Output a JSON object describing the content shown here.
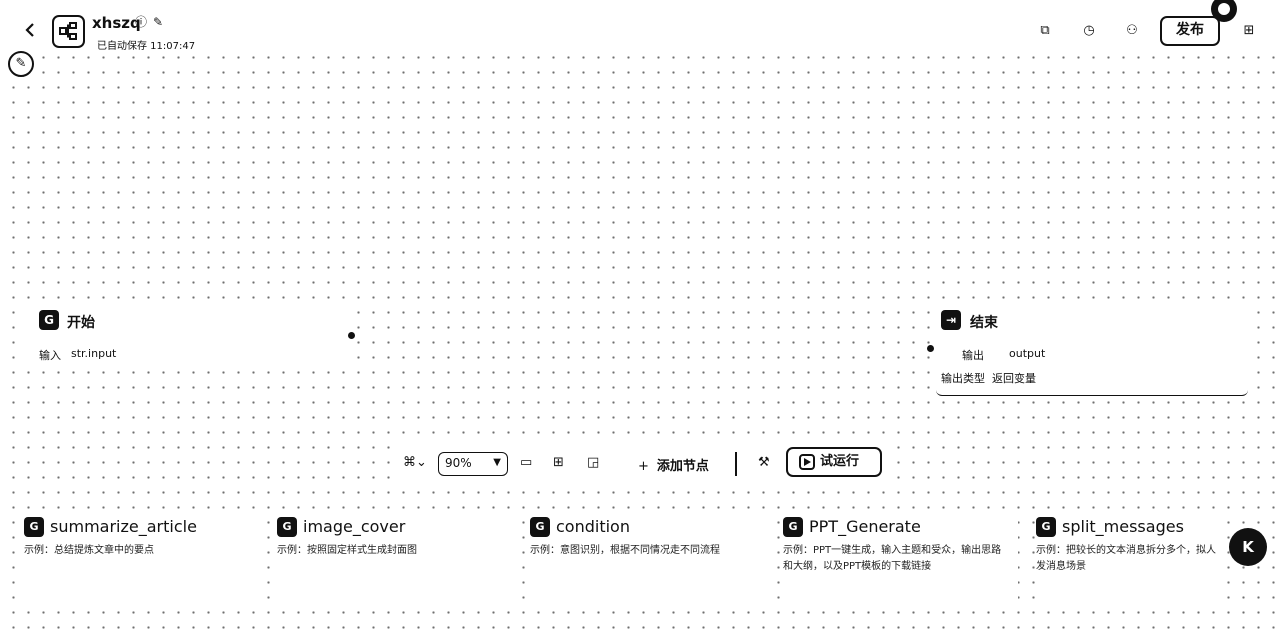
{
  "header": {
    "back_icon": "chevron-left-icon",
    "app_name": "xhszq",
    "autosave_text": "已自动保存 11:07:47",
    "publish_label": "发布"
  },
  "start_node": {
    "title": "开始",
    "input_label": "输入",
    "input_value": "str.input"
  },
  "end_node": {
    "title": "结束",
    "output_label": "输出",
    "output_value": "output",
    "output_type_label": "输出类型",
    "output_type_value": "返回变量"
  },
  "toolbar": {
    "zoom": "90%",
    "add_node_label": "添加节点",
    "run_label": "试运行"
  },
  "templates": [
    {
      "title": "summarize_article",
      "desc": "示例：总结提炼文章中的要点"
    },
    {
      "title": "image_cover",
      "desc": "示例：按照固定样式生成封面图"
    },
    {
      "title": "condition",
      "desc": "示例：意图识别，根据不同情况走不同流程"
    },
    {
      "title": "PPT_Generate",
      "desc": "示例：PPT一键生成，输入主题和受众，输出思路和大纲，以及PPT模板的下载链接"
    },
    {
      "title": "split_messages",
      "desc": "示例：把较长的文本消息拆分多个，拟人发消息场景"
    }
  ],
  "help": {
    "label": "K"
  }
}
